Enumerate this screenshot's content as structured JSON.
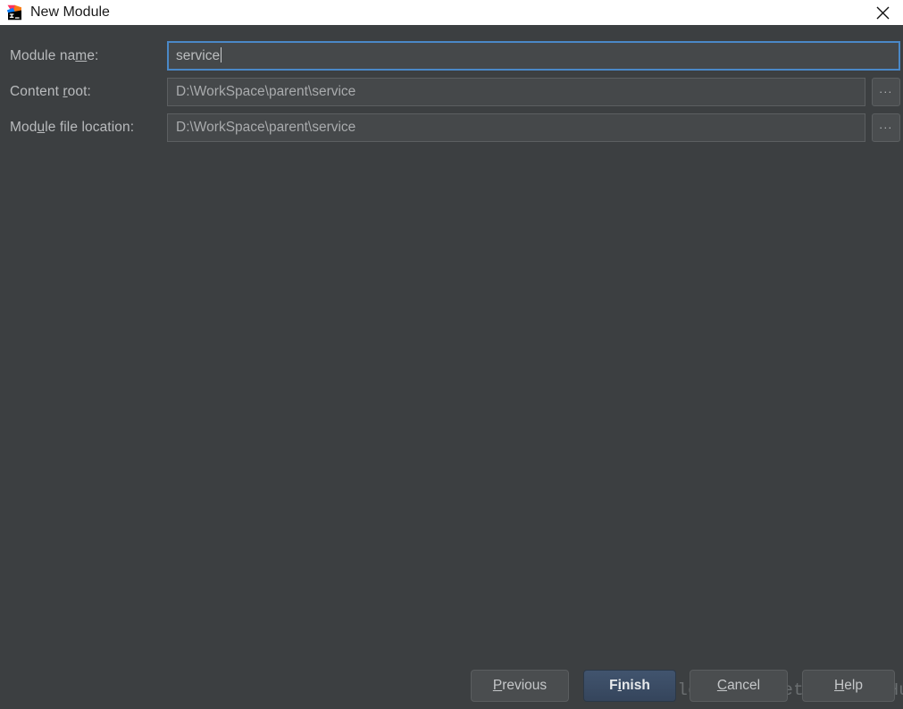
{
  "window": {
    "title": "New Module",
    "app_icon": "intellij-idea-icon",
    "close_icon": "close-icon",
    "titlebar_bg": "#ffffff",
    "body_bg": "#3c3f41"
  },
  "form": {
    "rows": [
      {
        "label_before": "Module na",
        "label_mnemonic": "m",
        "label_after": "e:",
        "value": "service",
        "focused": true,
        "has_browse": false,
        "browse_label": ""
      },
      {
        "label_before": "Content ",
        "label_mnemonic": "r",
        "label_after": "oot:",
        "value": "D:\\WorkSpace\\parent\\service",
        "focused": false,
        "has_browse": true,
        "browse_label": "..."
      },
      {
        "label_before": "Mod",
        "label_mnemonic": "u",
        "label_after": "le file location:",
        "value": "D:\\WorkSpace\\parent\\service",
        "focused": false,
        "has_browse": true,
        "browse_label": "..."
      }
    ]
  },
  "watermark": {
    "text": "http://blog.csdn.net/RobertoHuang"
  },
  "buttons": [
    {
      "before": "",
      "mnemonic": "P",
      "after": "revious",
      "style": "normal"
    },
    {
      "before": "F",
      "mnemonic": "i",
      "after": "nish",
      "style": "default"
    },
    {
      "before": "",
      "mnemonic": "C",
      "after": "ancel",
      "style": "normal"
    },
    {
      "before": "",
      "mnemonic": "H",
      "after": "elp",
      "style": "normal"
    }
  ],
  "colors": {
    "accent_focus": "#4a88c7",
    "default_button": "#3b4d66",
    "input_bg": "#45484a",
    "label_text": "#b9bbbd"
  }
}
